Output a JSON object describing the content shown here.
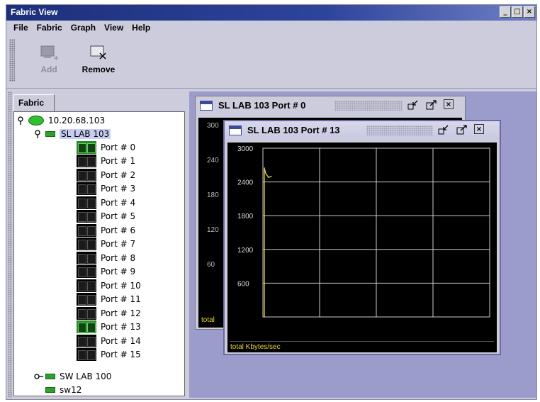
{
  "window": {
    "title": "Fabric View",
    "buttons": [
      "_",
      "□",
      "×"
    ]
  },
  "menu": [
    {
      "label": "File"
    },
    {
      "label": "Fabric"
    },
    {
      "label": "Graph"
    },
    {
      "label": "View"
    },
    {
      "label": "Help"
    }
  ],
  "toolbar": {
    "add_label": "Add",
    "remove_label": "Remove",
    "add_enabled": false
  },
  "sidebar": {
    "tab": "Fabric",
    "fabric_node": "10.20.68.103",
    "switch_selected": "SL LAB 103",
    "ports": [
      "Port # 0",
      "Port # 1",
      "Port # 2",
      "Port # 3",
      "Port # 4",
      "Port # 5",
      "Port # 6",
      "Port # 7",
      "Port # 8",
      "Port # 9",
      "Port # 10",
      "Port # 11",
      "Port # 12",
      "Port # 13",
      "Port # 14",
      "Port # 15"
    ],
    "highlighted_ports": [
      "Port # 0",
      "Port # 13"
    ],
    "switch2": "SW LAB 100",
    "switch3": "sw12"
  },
  "graphs": {
    "back": {
      "title": "SL LAB 103 Port # 0",
      "yticks": [
        "300",
        "240",
        "180",
        "120",
        "60"
      ],
      "footer": "total"
    },
    "front": {
      "title": "SL LAB 103 Port # 13",
      "footer": "total  Kbytes/sec",
      "line_color": "#e6d53a"
    }
  },
  "chart_data": {
    "type": "line",
    "title": "SL LAB 103 Port # 13",
    "ylabel": "total  Kbytes/sec",
    "yticks": [
      3000,
      2400,
      1800,
      1200,
      600
    ],
    "ylim": [
      0,
      3000
    ],
    "grid": true,
    "series": [
      {
        "values": [
          0,
          1300,
          2650,
          2550,
          2480,
          2500
        ]
      }
    ]
  }
}
